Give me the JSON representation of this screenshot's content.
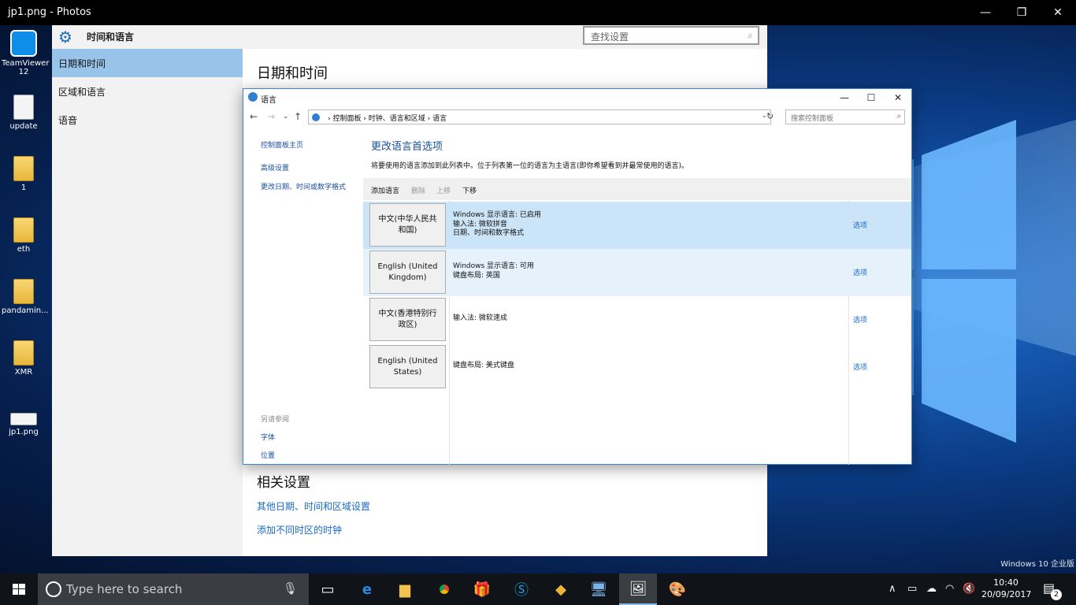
{
  "photos": {
    "title": "jp1.png - Photos",
    "minimize": "—",
    "restore": "❐",
    "close": "✕"
  },
  "desktop": {
    "icons": [
      {
        "label": "TeamViewer 12"
      },
      {
        "label": "update"
      },
      {
        "label": "1"
      },
      {
        "label": "eth"
      },
      {
        "label": "pandamin..."
      },
      {
        "label": "XMR"
      },
      {
        "label": "jp1.png"
      }
    ],
    "watermark": "Windows 10 企业版"
  },
  "settings": {
    "title": "时间和语言",
    "search_placeholder": "查找设置",
    "nav": [
      {
        "label": "日期和时间"
      },
      {
        "label": "区域和语言"
      },
      {
        "label": "语音"
      }
    ],
    "heading": "日期和时间",
    "related_heading": "相关设置",
    "related_links": [
      {
        "label": "其他日期、时间和区域设置"
      },
      {
        "label": "添加不同时区的时钟"
      }
    ]
  },
  "dialog": {
    "title": "语言",
    "breadcrumb": "›  控制面板  ›  时钟、语言和区域  ›  语言",
    "search_placeholder": "搜索控制面板",
    "side_links": [
      {
        "label": "控制面板主页"
      },
      {
        "label": "高级设置"
      },
      {
        "label": "更改日期、时间或数字格式"
      }
    ],
    "see_also": {
      "header": "另请参阅",
      "links": [
        {
          "label": "字体"
        },
        {
          "label": "位置"
        }
      ]
    },
    "heading": "更改语言首选项",
    "description": "将要使用的语言添加到此列表中。位于列表第一位的语言为主语言(即你希望看到并最常使用的语言)。",
    "toolbar": {
      "add": "添加语言",
      "remove": "删除",
      "up": "上移",
      "down": "下移"
    },
    "languages": [
      {
        "name": "中文(中华人民共和国)",
        "info": [
          "Windows 显示语言: 已启用",
          "输入法: 微软拼音",
          "日期、时间和数字格式"
        ],
        "option": "选项"
      },
      {
        "name": "English (United Kingdom)",
        "info": [
          "Windows 显示语言: 可用",
          "键盘布局: 英国"
        ],
        "option": "选项"
      },
      {
        "name": "中文(香港特别行政区)",
        "info": [
          "输入法: 微软速成"
        ],
        "option": "选项"
      },
      {
        "name": "English (United States)",
        "info": [
          "键盘布局: 美式键盘"
        ],
        "option": "选项"
      }
    ]
  },
  "taskbar": {
    "search_placeholder": "Type here to search",
    "time": "10:40",
    "date": "20/09/2017",
    "notification_count": "2"
  },
  "colors": {
    "accent": "#1a6ac8",
    "selected_row": "#cce4f7",
    "nav_active": "#99c4ea",
    "taskbar": "#101318"
  }
}
